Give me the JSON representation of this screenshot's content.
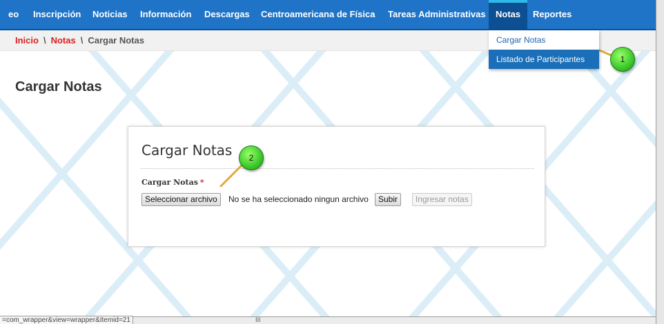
{
  "nav": {
    "items": [
      {
        "label": "eo"
      },
      {
        "label": "Inscripción"
      },
      {
        "label": "Noticias"
      },
      {
        "label": "Información"
      },
      {
        "label": "Descargas"
      },
      {
        "label": "Centroamericana de Física"
      },
      {
        "label": "Tareas Administrativas"
      },
      {
        "label": "Notas"
      },
      {
        "label": "Reportes"
      }
    ],
    "active": "Notas"
  },
  "dropdown": {
    "items": [
      {
        "label": "Cargar Notas"
      },
      {
        "label": "Listado de Participantes"
      }
    ]
  },
  "breadcrumb": {
    "home": "Inicio",
    "separator": "\\",
    "section": "Notas",
    "current": "Cargar Notas"
  },
  "page": {
    "title": "Cargar Notas"
  },
  "form": {
    "title": "Cargar Notas",
    "field_label": "Cargar Notas",
    "required_marker": "*",
    "file_button": "Seleccionar archivo",
    "file_status": "No se ha seleccionado ningun archivo",
    "upload_button": "Subir",
    "submit_button": "Ingresar notas"
  },
  "callouts": {
    "one": "1",
    "two": "2"
  },
  "status_bar": {
    "url": "=com_wrapper&view=wrapper&Itemid=21",
    "scroll_grip": "III"
  },
  "colors": {
    "nav_bg": "#1f74c8",
    "nav_active": "#0d4f93",
    "breadcrumb_link": "#d81f1f",
    "dropdown_highlight": "#1a6fb8",
    "callout": "#3ac92a"
  }
}
